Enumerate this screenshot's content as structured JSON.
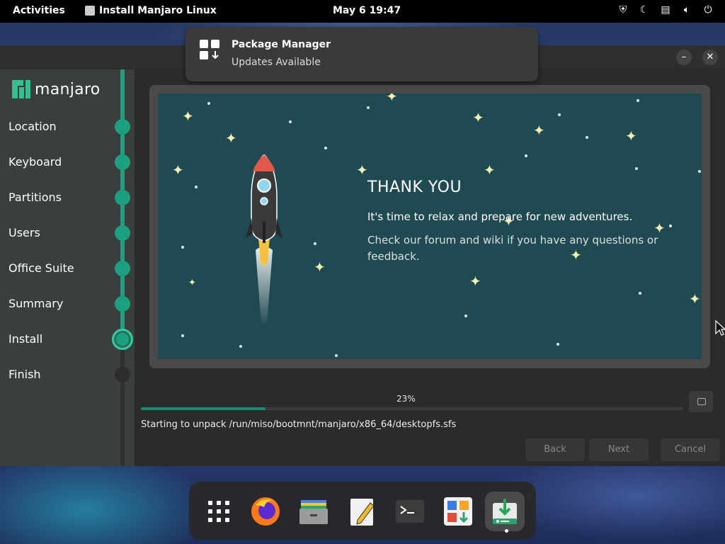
{
  "topbar": {
    "activities": "Activities",
    "app_name": "Install Manjaro Linux",
    "clock": "May 6  19:47",
    "tray_icons": [
      "shield-icon",
      "moon-icon",
      "keyboard-icon",
      "volume-icon",
      "power-icon"
    ]
  },
  "notification": {
    "title": "Package Manager",
    "body": "Updates Available",
    "icon": "package-manager-icon"
  },
  "window": {
    "buttons": {
      "minimize": "–",
      "close": "✕"
    }
  },
  "sidebar": {
    "logo_text": "manjaro",
    "steps": [
      {
        "label": "Location",
        "state": "done"
      },
      {
        "label": "Keyboard",
        "state": "done"
      },
      {
        "label": "Partitions",
        "state": "done"
      },
      {
        "label": "Users",
        "state": "done"
      },
      {
        "label": "Office Suite",
        "state": "done"
      },
      {
        "label": "Summary",
        "state": "done"
      },
      {
        "label": "Install",
        "state": "current"
      },
      {
        "label": "Finish",
        "state": "pending"
      }
    ]
  },
  "slide": {
    "title": "THANK YOU",
    "line1": "It's time to relax and prepare for new adventures.",
    "line2": "Check our forum and wiki if you have any questions or feedback."
  },
  "progress": {
    "percent_label": "23%",
    "fraction": 0.23,
    "status": "Starting to unpack /run/miso/bootmnt/manjaro/x86_64/desktopfs.sfs"
  },
  "buttons": {
    "back": "Back",
    "next": "Next",
    "cancel": "Cancel"
  },
  "dock": {
    "items": [
      "app-grid-icon",
      "firefox-icon",
      "files-icon",
      "text-editor-icon",
      "terminal-icon",
      "software-icon",
      "installer-icon"
    ],
    "active_item": "installer-icon"
  },
  "colors": {
    "accent": "#1aa07e",
    "slide_bg": "#1f4a52",
    "star": "#f2f2b0"
  }
}
